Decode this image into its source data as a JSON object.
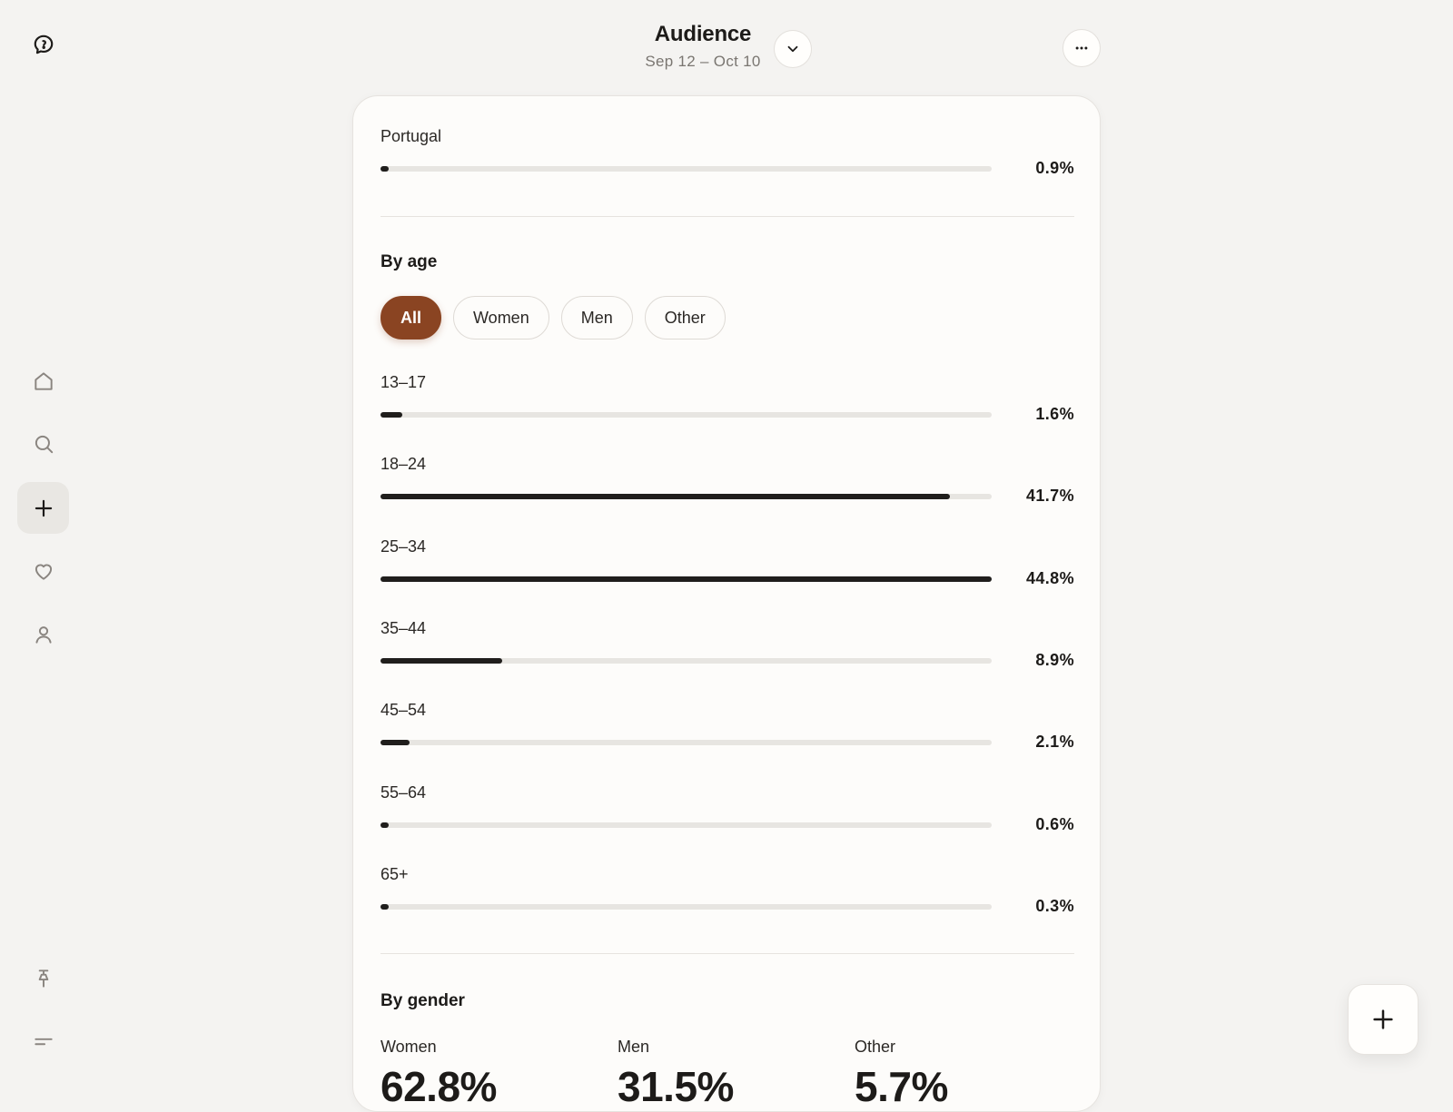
{
  "header": {
    "title": "Audience",
    "date_range": "Sep 12 – Oct 10"
  },
  "sidebar": {
    "items": [
      {
        "name": "home",
        "icon": "home-icon"
      },
      {
        "name": "search",
        "icon": "search-icon"
      },
      {
        "name": "create",
        "icon": "plus-icon",
        "active": true
      },
      {
        "name": "activity",
        "icon": "heart-icon"
      },
      {
        "name": "profile",
        "icon": "person-icon"
      }
    ],
    "bottom": [
      {
        "name": "pin",
        "icon": "pin-icon"
      },
      {
        "name": "menu",
        "icon": "menu-icon"
      }
    ]
  },
  "country_row": {
    "label": "Portugal",
    "value": "0.9%",
    "fraction": 0.009
  },
  "by_age": {
    "title": "By age",
    "filters": [
      {
        "label": "All",
        "active": true
      },
      {
        "label": "Women",
        "active": false
      },
      {
        "label": "Men",
        "active": false
      },
      {
        "label": "Other",
        "active": false
      }
    ],
    "rows": [
      {
        "label": "13–17",
        "value": "1.6%",
        "fraction": 0.036
      },
      {
        "label": "18–24",
        "value": "41.7%",
        "fraction": 0.931
      },
      {
        "label": "25–34",
        "value": "44.8%",
        "fraction": 1.0
      },
      {
        "label": "35–44",
        "value": "8.9%",
        "fraction": 0.199
      },
      {
        "label": "45–54",
        "value": "2.1%",
        "fraction": 0.047
      },
      {
        "label": "55–64",
        "value": "0.6%",
        "fraction": 0.013
      },
      {
        "label": "65+",
        "value": "0.3%",
        "fraction": 0.007
      }
    ]
  },
  "by_gender": {
    "title": "By gender",
    "items": [
      {
        "label": "Women",
        "value": "62.8%"
      },
      {
        "label": "Men",
        "value": "31.5%"
      },
      {
        "label": "Other",
        "value": "5.7%"
      }
    ]
  },
  "colors": {
    "accent": "#8a4422",
    "bar_fill": "#201e1c",
    "bar_track": "#e7e5e1",
    "background": "#f4f3f1",
    "card": "#fdfcfa"
  }
}
